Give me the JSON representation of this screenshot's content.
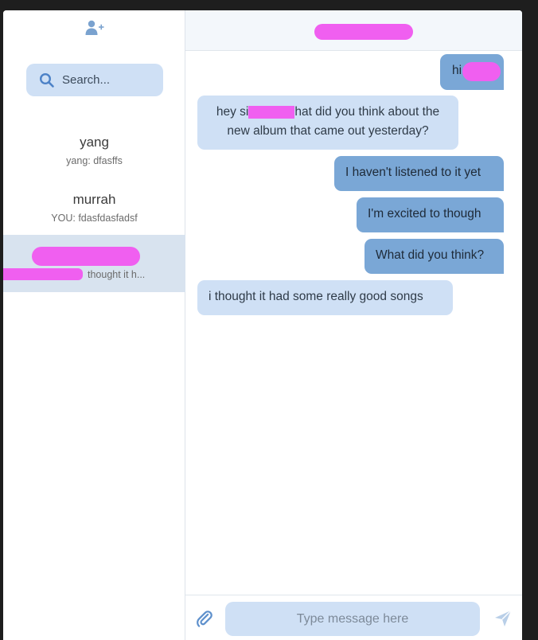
{
  "sidebar": {
    "add_user_icon": "add-user-icon",
    "search": {
      "placeholder": "Search...",
      "icon": "search-icon"
    },
    "conversations": [
      {
        "name": "yang",
        "preview": "yang: dfasffs"
      },
      {
        "name": "murrah",
        "preview": "YOU: fdasfdasfadsf"
      },
      {
        "name": "",
        "preview": "thought it h..."
      }
    ]
  },
  "chat": {
    "messages": [
      {
        "direction": "sent",
        "text": "hi"
      },
      {
        "direction": "received",
        "text_start": "hey si",
        "text_end": "hat did you think about the",
        "text_line2": "new album that came out yesterday?"
      },
      {
        "direction": "sent",
        "text": "I haven't listened to it yet"
      },
      {
        "direction": "sent",
        "text": "I'm excited to though"
      },
      {
        "direction": "sent",
        "text": "What did you think?"
      },
      {
        "direction": "received",
        "text": "i thought it had some really good songs"
      }
    ],
    "composer": {
      "placeholder": "Type message here",
      "attach_icon": "paperclip-icon",
      "send_icon": "send-icon"
    }
  },
  "colors": {
    "accent_light": "#cfe0f5",
    "accent_dark": "#7aa7d6",
    "redaction": "#f05ff0",
    "active_conversation": "#d8e3ef"
  }
}
